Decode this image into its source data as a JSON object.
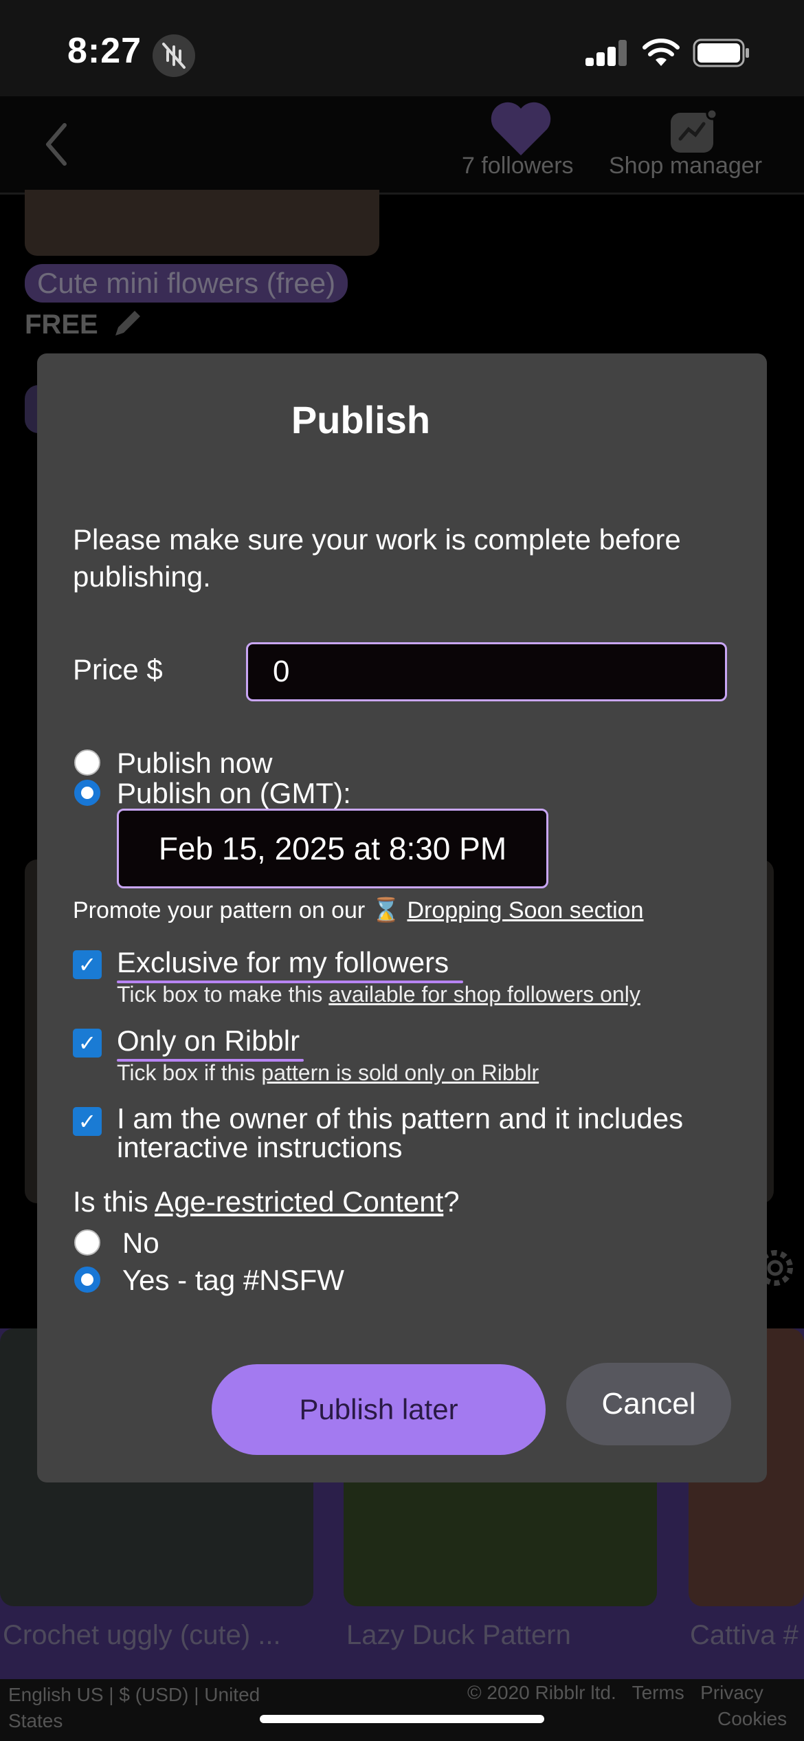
{
  "status_bar": {
    "time": "8:27"
  },
  "header": {
    "followers": "7 followers",
    "shop_manager": "Shop manager"
  },
  "background": {
    "item1_tag": "Cute mini flowers (free)",
    "item1_price": "FREE",
    "bottom_items": [
      "Crochet uggly (cute) ...",
      "Lazy Duck Pattern",
      "Cattiva #"
    ],
    "footer_left": "English US  |  $ (USD)  |  United States",
    "footer_right": "© 2020 Ribblr ltd.   Terms   Privacy",
    "footer_cookies": "Cookies"
  },
  "modal": {
    "title": "Publish",
    "intro": "Please make sure your work is complete before publishing.",
    "price_label": "Price $",
    "price_value": "0",
    "publish_now": "Publish now",
    "publish_on": "Publish on (GMT):",
    "date_value": "Feb 15, 2025 at 8:30 PM",
    "promote_prefix": "Promote your pattern on our",
    "promote_link": "Dropping Soon section",
    "exclusive_label": "Exclusive for my followers",
    "exclusive_sub_prefix": "Tick box to make this",
    "exclusive_sub_link": "available for shop followers only",
    "only_ribblr_label": "Only on Ribblr",
    "only_ribblr_sub_prefix": "Tick box if this",
    "only_ribblr_sub_link": "pattern is sold only on Ribblr",
    "owner_label": "I am the owner of this pattern and it includes interactive instructions",
    "age_q_prefix": "Is this",
    "age_q_link": "Age-restricted Content",
    "age_q_suffix": "?",
    "age_no": "No",
    "age_yes": "Yes - tag #NSFW",
    "publish_later_button": "Publish later",
    "cancel_button": "Cancel"
  },
  "colors": {
    "accent_purple": "#a37af0",
    "checkbox_blue": "#1a7bd4",
    "modal_bg": "#434343"
  }
}
